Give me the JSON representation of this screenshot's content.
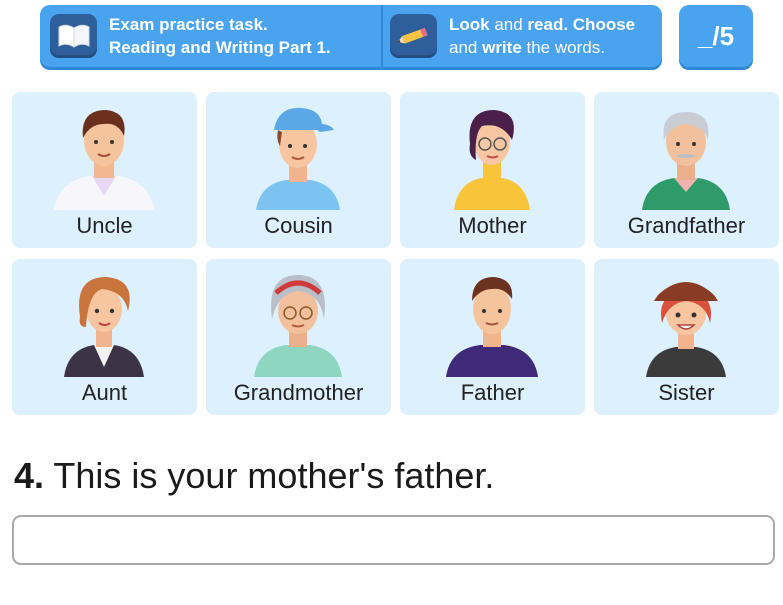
{
  "header": {
    "task1": {
      "line1": "Exam practice task.",
      "line2": "Reading and Writing Part 1."
    },
    "task2": {
      "look": "Look",
      "and1": " and ",
      "read": "read. Choose",
      "and2": "and ",
      "write": "write",
      "rest": " the words."
    },
    "score": "_/5"
  },
  "cards": [
    {
      "label": "Uncle",
      "icon": "uncle-avatar"
    },
    {
      "label": "Cousin",
      "icon": "cousin-avatar"
    },
    {
      "label": "Mother",
      "icon": "mother-avatar"
    },
    {
      "label": "Grandfather",
      "icon": "grandfather-avatar"
    },
    {
      "label": "Aunt",
      "icon": "aunt-avatar"
    },
    {
      "label": "Grandmother",
      "icon": "grandmother-avatar"
    },
    {
      "label": "Father",
      "icon": "father-avatar"
    },
    {
      "label": "Sister",
      "icon": "sister-avatar"
    }
  ],
  "question": {
    "number": "4.",
    "text": " This is your mother's father."
  },
  "answer": {
    "value": "",
    "placeholder": ""
  },
  "colors": {
    "header": "#4aa3ef",
    "card": "#ddf0fd",
    "iconTile": "#2e5f9a"
  }
}
